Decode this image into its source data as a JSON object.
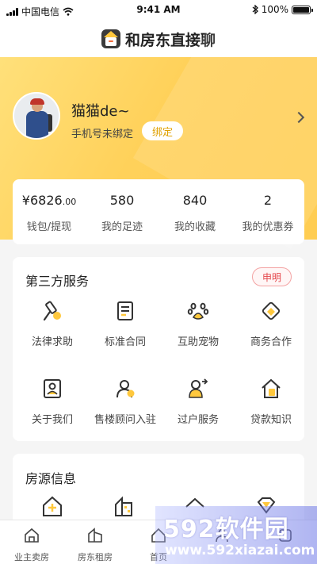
{
  "status_bar": {
    "carrier": "中国电信",
    "time": "9:41 AM",
    "battery": "100%",
    "battery_level": 1.0
  },
  "header": {
    "title": "和房东直接聊",
    "logo_icon": "house-chat-logo"
  },
  "profile": {
    "username": "猫猫de~",
    "phone_status": "手机号未绑定",
    "bind_label": "绑定"
  },
  "stats": [
    {
      "value": "¥6826",
      "value_small": ".00",
      "label": "钱包/提现"
    },
    {
      "value": "580",
      "label": "我的足迹"
    },
    {
      "value": "840",
      "label": "我的收藏"
    },
    {
      "value": "2",
      "label": "我的优惠券"
    }
  ],
  "services": {
    "title": "第三方服务",
    "notice_label": "申明",
    "items": [
      {
        "label": "法律求助",
        "icon": "gavel-icon"
      },
      {
        "label": "标准合同",
        "icon": "contract-icon"
      },
      {
        "label": "互助宠物",
        "icon": "paw-icon"
      },
      {
        "label": "商务合作",
        "icon": "handshake-icon"
      },
      {
        "label": "关于我们",
        "icon": "id-card-icon"
      },
      {
        "label": "售楼顾问入驻",
        "icon": "consultant-icon"
      },
      {
        "label": "过户服务",
        "icon": "transfer-icon"
      },
      {
        "label": "贷款知识",
        "icon": "loan-house-icon"
      }
    ]
  },
  "listings": {
    "title": "房源信息"
  },
  "tabs": [
    {
      "label": "业主卖房",
      "icon": "house-tab-icon"
    },
    {
      "label": "房东租房",
      "icon": "house-rent-tab-icon"
    },
    {
      "label": "首页",
      "icon": "home-tab-icon"
    },
    {
      "label": "",
      "icon": "people-tab-icon"
    },
    {
      "label": "",
      "icon": "mine-tab-icon"
    }
  ],
  "watermark": {
    "logo": "592软件园",
    "url": "www.592xiazai.com"
  },
  "colors": {
    "accent": "#ffd15a",
    "accent_text": "#e0a100",
    "notice_red": "#e5484d"
  }
}
